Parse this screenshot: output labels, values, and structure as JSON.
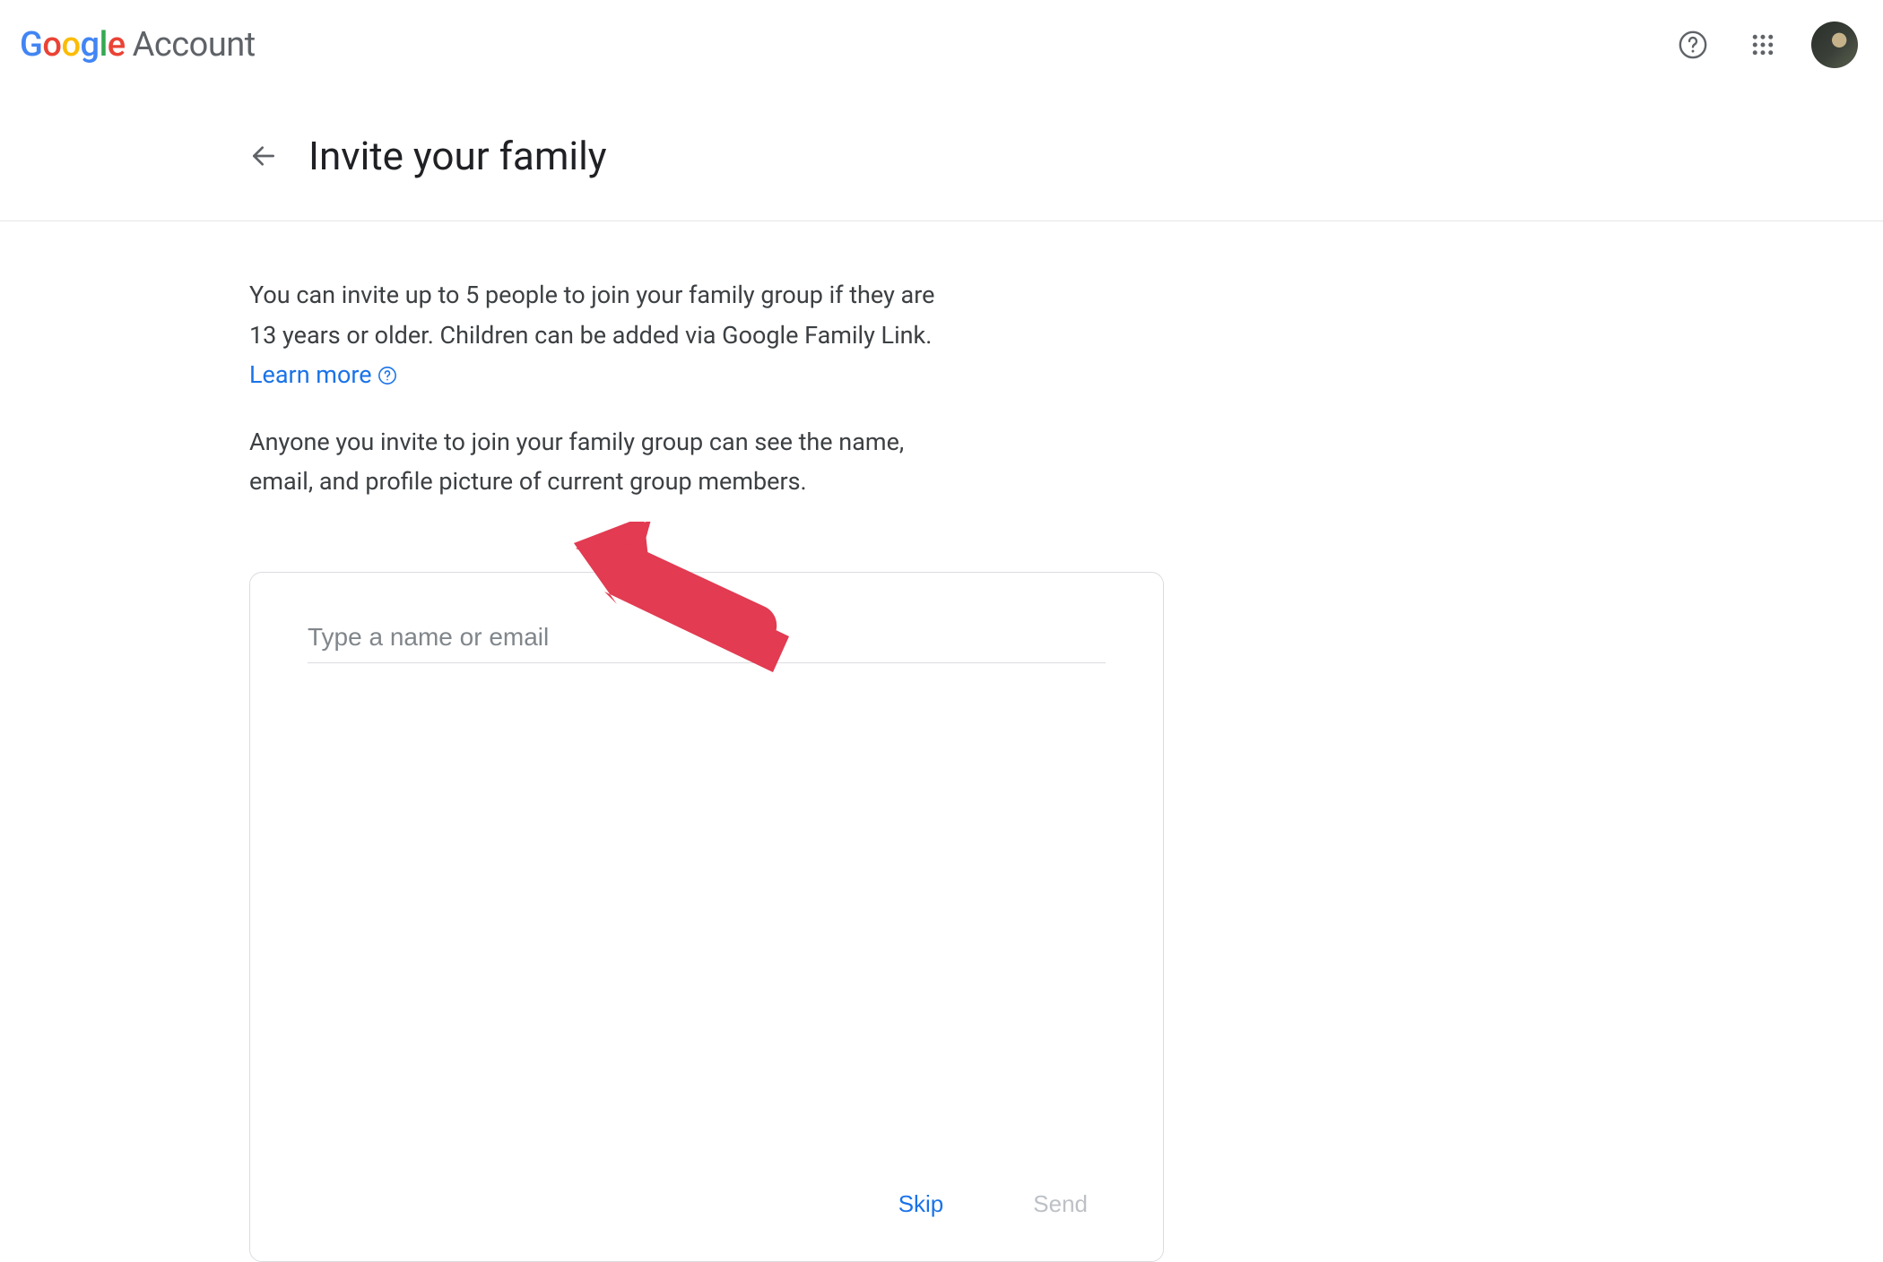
{
  "header": {
    "logo_text": "Google",
    "product": "Account"
  },
  "page": {
    "title": "Invite your family",
    "info_text_1a": "You can invite up to 5 people to join your family group if they are 13 years or older. Children can be added via Google Family Link. ",
    "learn_more": "Learn more",
    "info_text_2": "Anyone you invite to join your family group can see the name, email, and profile picture of current group members."
  },
  "card": {
    "input_placeholder": "Type a name or email",
    "input_value": "",
    "skip_label": "Skip",
    "send_label": "Send"
  },
  "colors": {
    "link": "#1a73e8",
    "text_primary": "#202124",
    "text_secondary": "#5f6368",
    "border": "#dadce0"
  }
}
